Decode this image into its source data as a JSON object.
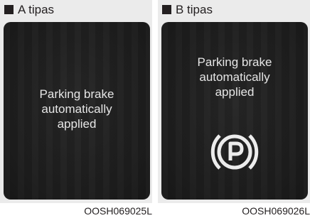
{
  "panels": [
    {
      "heading": "A tipas",
      "message_lines": [
        "Parking brake",
        "automatically",
        "applied"
      ],
      "code": "OOSH069025L"
    },
    {
      "heading": "B tipas",
      "message_lines": [
        "Parking brake",
        "automatically",
        "applied"
      ],
      "icon": "parking-brake-icon",
      "code": "OOSH069026L"
    }
  ]
}
